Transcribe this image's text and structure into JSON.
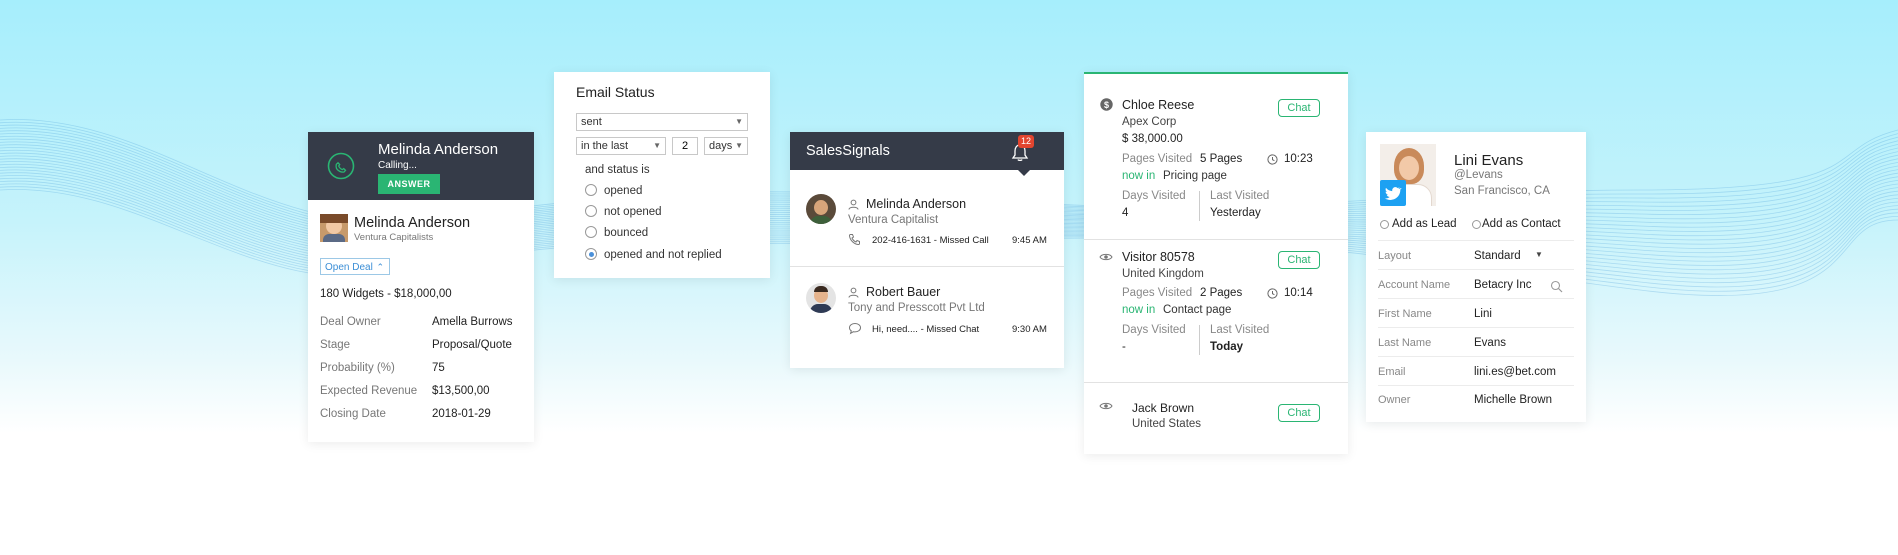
{
  "colors": {
    "accent_green": "#2ab573",
    "header_dark": "#353b48",
    "badge_red": "#e2452f",
    "link_blue": "#3b8ed6"
  },
  "call_card": {
    "caller_name": "Melinda Anderson",
    "status": "Calling...",
    "answer_label": "ANSWER",
    "contact_name": "Melinda Anderson",
    "contact_company": "Ventura Capitalists",
    "open_deal_label": "Open Deal",
    "deal_title": "180 Widgets - $18,000,00",
    "fields": [
      {
        "label": "Deal Owner",
        "value": "Amella Burrows"
      },
      {
        "label": "Stage",
        "value": "Proposal/Quote"
      },
      {
        "label": "Probability (%)",
        "value": "75"
      },
      {
        "label": "Expected Revenue",
        "value": "$13,500,00"
      },
      {
        "label": "Closing Date",
        "value": "2018-01-29"
      }
    ]
  },
  "email_card": {
    "title": "Email Status",
    "status_select": "sent",
    "period_select": "in the last",
    "number_value": "2",
    "unit_select": "days",
    "prompt": "and status is",
    "options": [
      {
        "label": "opened",
        "checked": false
      },
      {
        "label": "not opened",
        "checked": false
      },
      {
        "label": "bounced",
        "checked": false
      },
      {
        "label": "opened and not replied",
        "checked": true
      }
    ]
  },
  "signals_card": {
    "title": "SalesSignals",
    "badge_count": "12",
    "items": [
      {
        "name": "Melinda Anderson",
        "company": "Ventura Capitalist",
        "detail": "202-416-1631 - Missed Call",
        "time": "9:45 AM"
      },
      {
        "name": "Robert Bauer",
        "company": "Tony and Presscott Pvt Ltd",
        "detail": "Hi, need.... - Missed Chat",
        "time": "9:30 AM"
      }
    ]
  },
  "visitors_card": {
    "chat_label": "Chat",
    "visitor1": {
      "name": "Chloe Reese",
      "company": "Apex Corp",
      "amount": "$ 38,000.00",
      "pages_label": "Pages Visited",
      "pages_value": "5 Pages",
      "time": "10:23",
      "now_in_label": "now in",
      "now_in_page": "Pricing page",
      "days_label": "Days Visited",
      "days_value": "4",
      "last_label": "Last Visited",
      "last_value": "Yesterday"
    },
    "visitor2": {
      "name": "Visitor 80578",
      "country": "United Kingdom",
      "pages_label": "Pages Visited",
      "pages_value": "2 Pages",
      "time": "10:14",
      "now_in_label": "now in",
      "now_in_page": "Contact page",
      "days_label": "Days Visited",
      "days_value": "-",
      "last_label": "Last Visited",
      "last_value": "Today"
    },
    "visitor3": {
      "name": "Jack Brown",
      "country": "United States"
    }
  },
  "contact_card": {
    "name": "Lini Evans",
    "handle": "@Levans",
    "location": "San Francisco, CA",
    "add_lead_label": "Add as Lead",
    "add_contact_label": "Add as Contact",
    "fields": [
      {
        "label": "Layout",
        "value": "Standard"
      },
      {
        "label": "Account Name",
        "value": "Betacry Inc"
      },
      {
        "label": "First Name",
        "value": "Lini"
      },
      {
        "label": "Last Name",
        "value": "Evans"
      },
      {
        "label": "Email",
        "value": "lini.es@bet.com"
      },
      {
        "label": "Owner",
        "value": "Michelle Brown"
      }
    ]
  }
}
